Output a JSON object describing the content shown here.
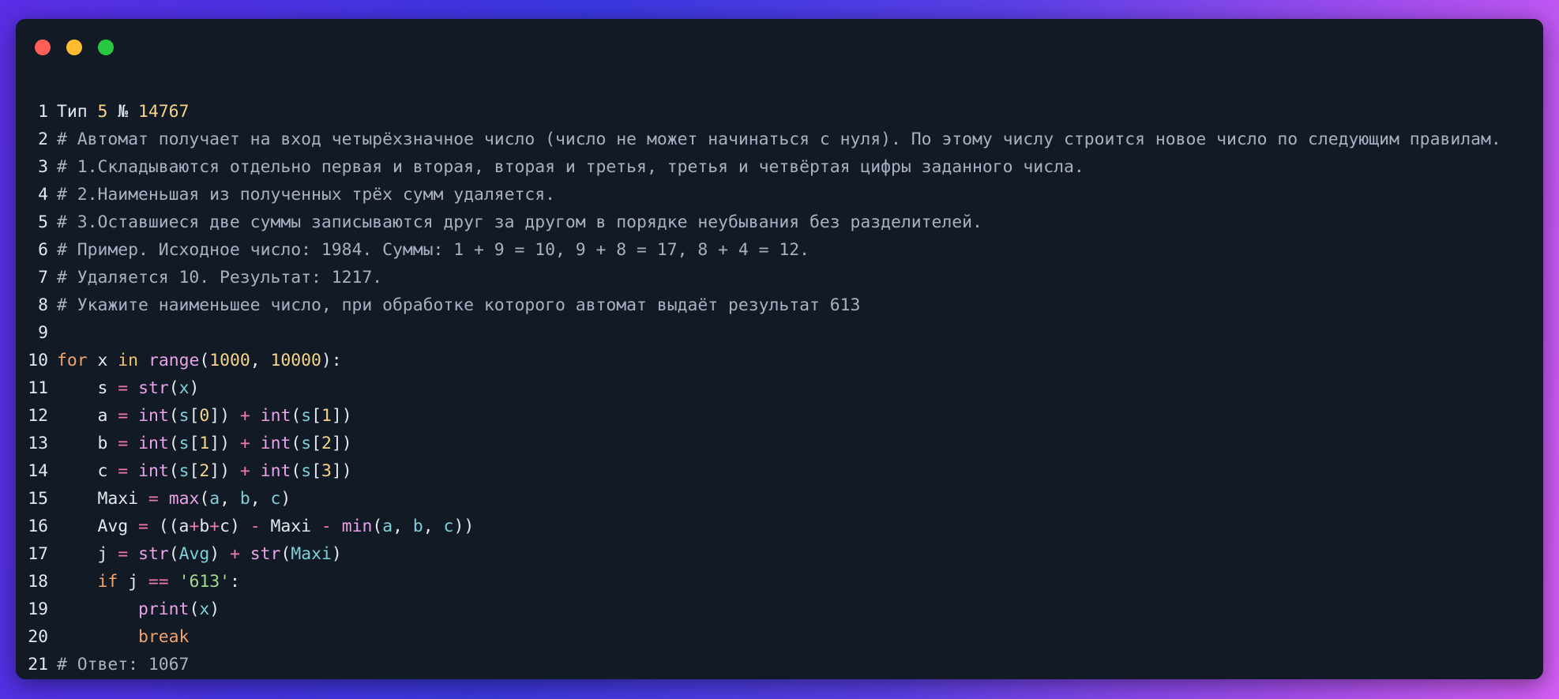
{
  "window": {
    "controls": [
      "close",
      "minimize",
      "maximize"
    ],
    "colors": {
      "background": "#121a25",
      "close": "#ff5f57",
      "minimize": "#febc2e",
      "maximize": "#28c840"
    }
  },
  "code": {
    "lines": [
      {
        "n": "1",
        "tokens": [
          [
            "plain",
            "Тип "
          ],
          [
            "num",
            "5"
          ],
          [
            "plain",
            " № "
          ],
          [
            "num",
            "14767"
          ]
        ]
      },
      {
        "n": "2",
        "tokens": [
          [
            "comment",
            "# Автомат получает на вход четырёхзначное число (число не может начинаться с нуля). По этому числу строится новое число по следующим правилам."
          ]
        ]
      },
      {
        "n": "3",
        "tokens": [
          [
            "comment",
            "# 1.Складываются отдельно первая и вторая, вторая и третья, третья и четвёртая цифры заданного числа."
          ]
        ]
      },
      {
        "n": "4",
        "tokens": [
          [
            "comment",
            "# 2.Наименьшая из полученных трёх сумм удаляется."
          ]
        ]
      },
      {
        "n": "5",
        "tokens": [
          [
            "comment",
            "# 3.Оставшиеся две суммы записываются друг за другом в порядке неубывания без разделителей."
          ]
        ]
      },
      {
        "n": "6",
        "tokens": [
          [
            "comment",
            "# Пример. Исходное число: 1984. Суммы: 1 + 9 = 10, 9 + 8 = 17, 8 + 4 = 12."
          ]
        ]
      },
      {
        "n": "7",
        "tokens": [
          [
            "comment",
            "# Удаляется 10. Результат: 1217."
          ]
        ]
      },
      {
        "n": "8",
        "tokens": [
          [
            "comment",
            "# Укажите наименьшее число, при обработке которого автомат выдаёт результат 613"
          ]
        ]
      },
      {
        "n": "9",
        "tokens": []
      },
      {
        "n": "10",
        "tokens": [
          [
            "kw",
            "for"
          ],
          [
            "plain",
            " x "
          ],
          [
            "kw2",
            "in"
          ],
          [
            "plain",
            " "
          ],
          [
            "fn",
            "range"
          ],
          [
            "plain",
            "("
          ],
          [
            "num",
            "1000"
          ],
          [
            "plain",
            ", "
          ],
          [
            "num",
            "10000"
          ],
          [
            "plain",
            "):"
          ]
        ]
      },
      {
        "n": "11",
        "tokens": [
          [
            "plain",
            "    s "
          ],
          [
            "op",
            "="
          ],
          [
            "plain",
            " "
          ],
          [
            "fn",
            "str"
          ],
          [
            "plain",
            "("
          ],
          [
            "var",
            "x"
          ],
          [
            "plain",
            ")"
          ]
        ]
      },
      {
        "n": "12",
        "tokens": [
          [
            "plain",
            "    a "
          ],
          [
            "op",
            "="
          ],
          [
            "plain",
            " "
          ],
          [
            "fn",
            "int"
          ],
          [
            "plain",
            "("
          ],
          [
            "var",
            "s"
          ],
          [
            "plain",
            "["
          ],
          [
            "num",
            "0"
          ],
          [
            "plain",
            "]) "
          ],
          [
            "op",
            "+"
          ],
          [
            "plain",
            " "
          ],
          [
            "fn",
            "int"
          ],
          [
            "plain",
            "("
          ],
          [
            "var",
            "s"
          ],
          [
            "plain",
            "["
          ],
          [
            "num",
            "1"
          ],
          [
            "plain",
            "])"
          ]
        ]
      },
      {
        "n": "13",
        "tokens": [
          [
            "plain",
            "    b "
          ],
          [
            "op",
            "="
          ],
          [
            "plain",
            " "
          ],
          [
            "fn",
            "int"
          ],
          [
            "plain",
            "("
          ],
          [
            "var",
            "s"
          ],
          [
            "plain",
            "["
          ],
          [
            "num",
            "1"
          ],
          [
            "plain",
            "]) "
          ],
          [
            "op",
            "+"
          ],
          [
            "plain",
            " "
          ],
          [
            "fn",
            "int"
          ],
          [
            "plain",
            "("
          ],
          [
            "var",
            "s"
          ],
          [
            "plain",
            "["
          ],
          [
            "num",
            "2"
          ],
          [
            "plain",
            "])"
          ]
        ]
      },
      {
        "n": "14",
        "tokens": [
          [
            "plain",
            "    c "
          ],
          [
            "op",
            "="
          ],
          [
            "plain",
            " "
          ],
          [
            "fn",
            "int"
          ],
          [
            "plain",
            "("
          ],
          [
            "var",
            "s"
          ],
          [
            "plain",
            "["
          ],
          [
            "num",
            "2"
          ],
          [
            "plain",
            "]) "
          ],
          [
            "op",
            "+"
          ],
          [
            "plain",
            " "
          ],
          [
            "fn",
            "int"
          ],
          [
            "plain",
            "("
          ],
          [
            "var",
            "s"
          ],
          [
            "plain",
            "["
          ],
          [
            "num",
            "3"
          ],
          [
            "plain",
            "])"
          ]
        ]
      },
      {
        "n": "15",
        "tokens": [
          [
            "plain",
            "    Maxi "
          ],
          [
            "op",
            "="
          ],
          [
            "plain",
            " "
          ],
          [
            "fn",
            "max"
          ],
          [
            "plain",
            "("
          ],
          [
            "var",
            "a"
          ],
          [
            "plain",
            ", "
          ],
          [
            "var",
            "b"
          ],
          [
            "plain",
            ", "
          ],
          [
            "var",
            "c"
          ],
          [
            "plain",
            ")"
          ]
        ]
      },
      {
        "n": "16",
        "tokens": [
          [
            "plain",
            "    Avg "
          ],
          [
            "op",
            "="
          ],
          [
            "plain",
            " ((a"
          ],
          [
            "op",
            "+"
          ],
          [
            "plain",
            "b"
          ],
          [
            "op",
            "+"
          ],
          [
            "plain",
            "c) "
          ],
          [
            "op",
            "-"
          ],
          [
            "plain",
            " Maxi "
          ],
          [
            "op",
            "-"
          ],
          [
            "plain",
            " "
          ],
          [
            "fn",
            "min"
          ],
          [
            "plain",
            "("
          ],
          [
            "var",
            "a"
          ],
          [
            "plain",
            ", "
          ],
          [
            "var",
            "b"
          ],
          [
            "plain",
            ", "
          ],
          [
            "var",
            "c"
          ],
          [
            "plain",
            "))"
          ]
        ]
      },
      {
        "n": "17",
        "tokens": [
          [
            "plain",
            "    j "
          ],
          [
            "op",
            "="
          ],
          [
            "plain",
            " "
          ],
          [
            "fn",
            "str"
          ],
          [
            "plain",
            "("
          ],
          [
            "var",
            "Avg"
          ],
          [
            "plain",
            ") "
          ],
          [
            "op",
            "+"
          ],
          [
            "plain",
            " "
          ],
          [
            "fn",
            "str"
          ],
          [
            "plain",
            "("
          ],
          [
            "var",
            "Maxi"
          ],
          [
            "plain",
            ")"
          ]
        ]
      },
      {
        "n": "18",
        "tokens": [
          [
            "plain",
            "    "
          ],
          [
            "kw",
            "if"
          ],
          [
            "plain",
            " j "
          ],
          [
            "op",
            "=="
          ],
          [
            "plain",
            " "
          ],
          [
            "str",
            "'613'"
          ],
          [
            "plain",
            ":"
          ]
        ]
      },
      {
        "n": "19",
        "tokens": [
          [
            "plain",
            "        "
          ],
          [
            "fn",
            "print"
          ],
          [
            "plain",
            "("
          ],
          [
            "var",
            "x"
          ],
          [
            "plain",
            ")"
          ]
        ]
      },
      {
        "n": "20",
        "tokens": [
          [
            "plain",
            "        "
          ],
          [
            "kw",
            "break"
          ]
        ]
      },
      {
        "n": "21",
        "tokens": [
          [
            "comment",
            "# Ответ: 1067"
          ]
        ]
      }
    ]
  }
}
